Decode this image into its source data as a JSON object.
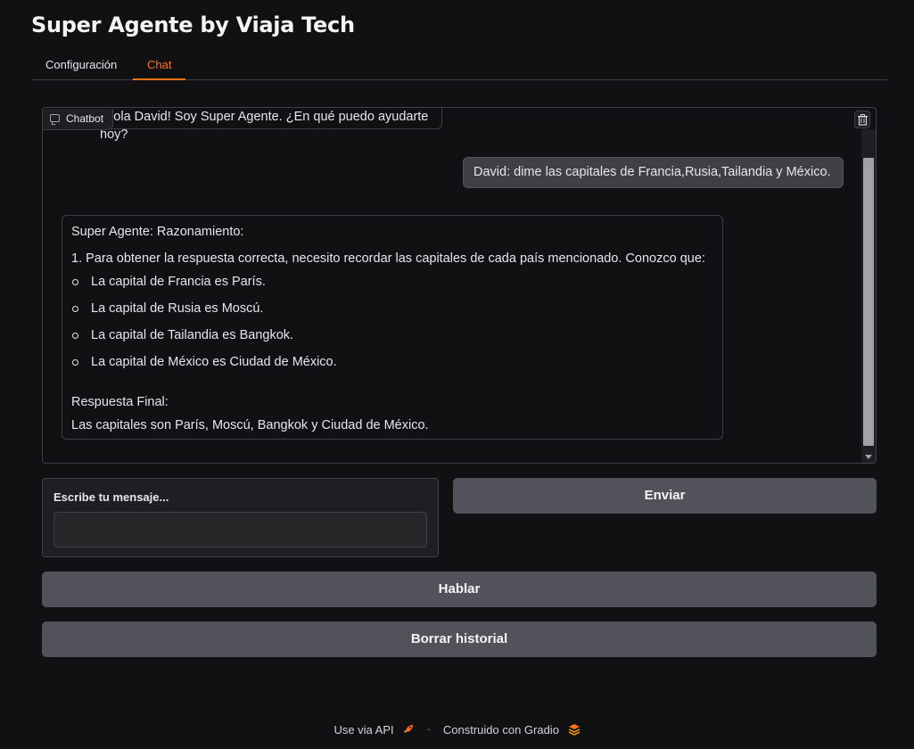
{
  "app": {
    "title": "Super Agente by Viaja Tech"
  },
  "tabs": [
    {
      "label": "Configuración",
      "active": false
    },
    {
      "label": "Chat",
      "active": true
    }
  ],
  "chatbot": {
    "label": "Chatbot",
    "messages": {
      "greeting": "¡Hola David! Soy Super Agente. ¿En qué puedo ayudarte hoy?",
      "user": "David: dime las capitales de Francia,Rusia,Tailandia y México.",
      "bot_heading": "Super Agente: Razonamiento:",
      "bot_step": "1. Para obtener la respuesta correcta, necesito recordar las capitales de cada país mencionado. Conozco que:",
      "bot_items": [
        "La capital de Francia es París.",
        "La capital de Rusia es Moscú.",
        "La capital de Tailandia es Bangkok.",
        "La capital de México es Ciudad de México."
      ],
      "final_label": "Respuesta Final:",
      "final_text": "Las capitales son París, Moscú, Bangkok y Ciudad de México."
    }
  },
  "input": {
    "label": "Escribe tu mensaje...",
    "value": ""
  },
  "buttons": {
    "send": "Enviar",
    "talk": "Hablar",
    "clear": "Borrar historial"
  },
  "footer": {
    "api": "Use via API",
    "separator": "·",
    "built": "Construido con Gradio"
  },
  "colors": {
    "accent": "#f97316",
    "background": "#111113",
    "button": "#52525b"
  }
}
